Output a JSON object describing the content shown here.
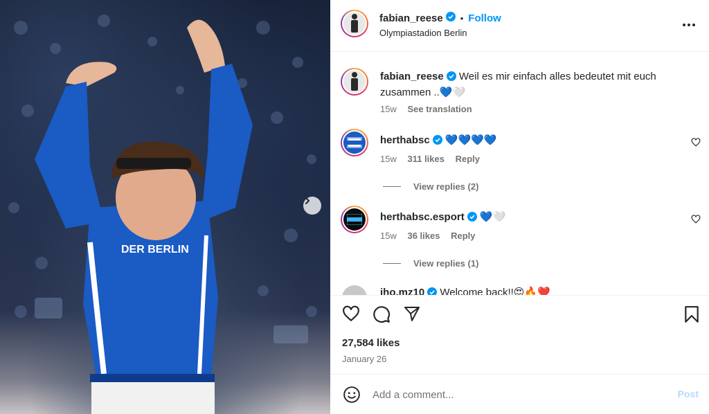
{
  "post": {
    "author": "fabian_reese",
    "follow_label": "Follow",
    "dot": "•",
    "location": "Olympiastadion Berlin",
    "photo_text": "DER BERLIN"
  },
  "caption": {
    "username": "fabian_reese",
    "text": "Weil es mir einfach alles bedeutet mit euch zusammen ..💙🤍",
    "time": "15w",
    "see_translation": "See translation"
  },
  "comments": [
    {
      "username": "herthabsc",
      "text": "💙💙💙💙",
      "time": "15w",
      "likes": "311 likes",
      "reply": "Reply",
      "view_replies": "View replies (2)"
    },
    {
      "username": "herthabsc.esport",
      "text": "💙🤍",
      "time": "15w",
      "likes": "36 likes",
      "reply": "Reply",
      "view_replies": "View replies (1)"
    },
    {
      "username": "jho.mz10",
      "text": "Welcome back!!😍🔥❤️"
    }
  ],
  "footer": {
    "likes": "27,584 likes",
    "date": "January 26",
    "comment_placeholder": "Add a comment...",
    "post_label": "Post"
  },
  "colors": {
    "accent": "#0095f6",
    "jersey": "#1a5bc4",
    "muted": "#737373"
  }
}
